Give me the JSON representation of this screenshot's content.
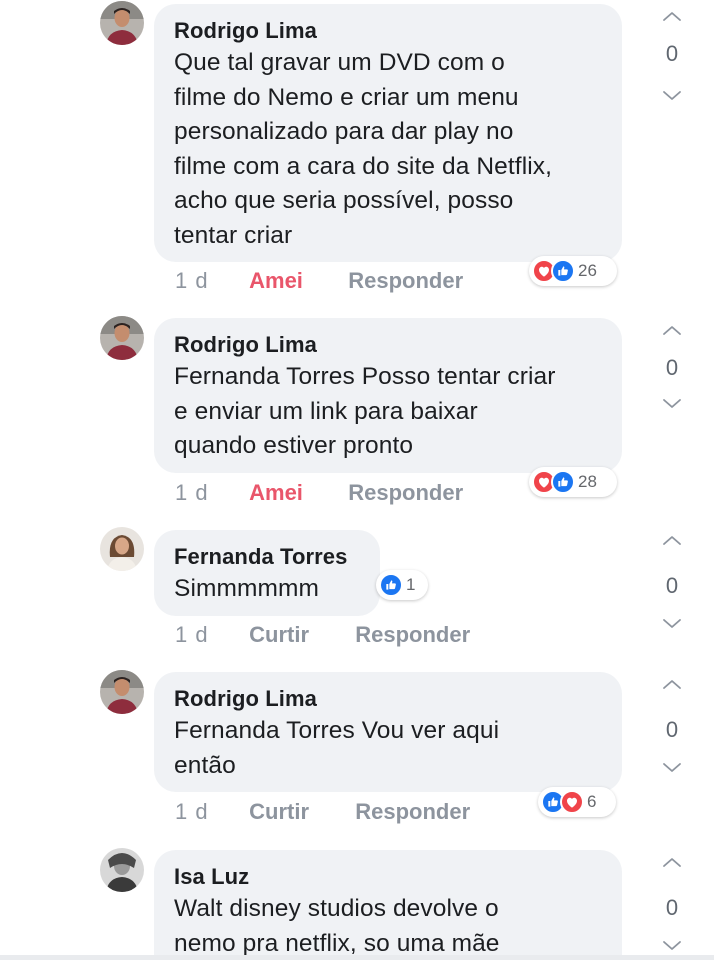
{
  "comments": [
    {
      "author": "Rodrigo Lima",
      "text": "Que tal gravar um DVD com o\nfilme do Nemo e criar um menu\npersonalizado para dar play no\nfilme com a cara do site da Netflix,\nacho que seria possível, posso\ntentar criar",
      "time": "1 d",
      "reaction_label": "Amei",
      "reply_label": "Responder",
      "reaction_icons": [
        "heart-icon",
        "thumbs-up-icon"
      ],
      "reaction_count": "26",
      "score": "0"
    },
    {
      "author": "Rodrigo Lima",
      "text": "Fernanda Torres Posso tentar criar\ne enviar um link para baixar\nquando estiver pronto",
      "time": "1 d",
      "reaction_label": "Amei",
      "reply_label": "Responder",
      "reaction_icons": [
        "heart-icon",
        "thumbs-up-icon"
      ],
      "reaction_count": "28",
      "score": "0"
    },
    {
      "author": "Fernanda Torres",
      "text": "Simmmmmm",
      "time": "1 d",
      "reaction_label": "Curtir",
      "reply_label": "Responder",
      "reaction_icons": [
        "thumbs-up-icon"
      ],
      "reaction_count": "1",
      "score": "0"
    },
    {
      "author": "Rodrigo Lima",
      "text": "Fernanda Torres Vou ver aqui\nentão",
      "time": "1 d",
      "reaction_label": "Curtir",
      "reply_label": "Responder",
      "reaction_icons": [
        "thumbs-up-icon",
        "heart-icon"
      ],
      "reaction_count": "6",
      "score": "0"
    },
    {
      "author": "Isa Luz",
      "text": "Walt disney studios devolve o\nnemo pra netflix, so uma mãe",
      "score": "0"
    }
  ],
  "colors": {
    "bubble": "#f0f2f5",
    "love": "#f0444a",
    "like": "#1b76f2",
    "loved_text": "#e9566b",
    "meta_text": "#8d949e"
  }
}
